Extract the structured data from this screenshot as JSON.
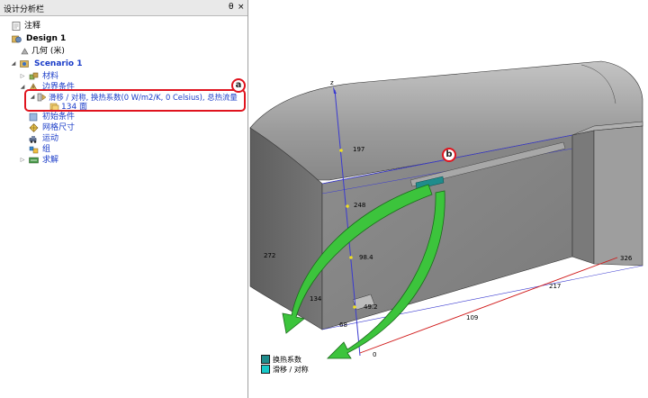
{
  "panel": {
    "title": "设计分析栏",
    "pin_label": "θ",
    "close_label": "×"
  },
  "tree": {
    "notes": "注释",
    "design": "Design 1",
    "geometry": "几何 (米)",
    "scenario": "Scenario 1",
    "materials": "材料",
    "boundary": "边界条件",
    "bc_item": "滑移 / 对称, 换热系数(0 W/m2/K, 0 Celsius), 总热流量",
    "faces": "134 面",
    "initial": "初始条件",
    "mesh": "网格尺寸",
    "motion": "运动",
    "group": "组",
    "solve": "求解"
  },
  "callouts": {
    "a": "a",
    "b": "b"
  },
  "viewport": {
    "axis_label": "z",
    "dimensions": {
      "d197": "197",
      "d248": "248",
      "d272": "272",
      "d98": "98.4",
      "d134": "134",
      "d68": "68",
      "d49": "49.2",
      "d0": "0",
      "d109": "109",
      "d217": "217",
      "d326": "326"
    },
    "legend": [
      {
        "label": "换热系数",
        "color": "#1f8c8c"
      },
      {
        "label": "滑移 / 对称",
        "color": "#17c8c8"
      }
    ]
  },
  "colors": {
    "highlight": "#e0141e",
    "arrow": "#3cc43c",
    "selection": "#1a3cc8"
  }
}
